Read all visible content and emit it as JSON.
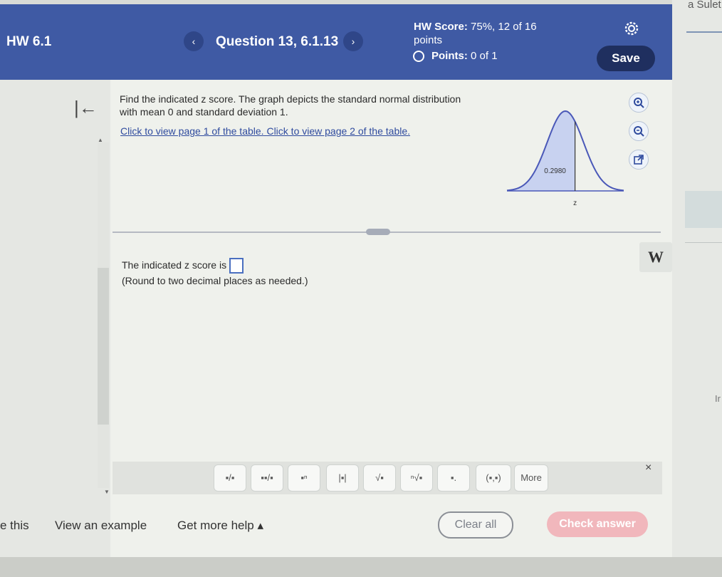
{
  "header": {
    "assignment": "HW 6.1",
    "question": "Question 13, 6.1.13",
    "prev_icon": "chevron-left-icon",
    "next_icon": "chevron-right-icon",
    "score_label": "HW Score:",
    "score_value": "75%, 12 of 16",
    "score_unit": "points",
    "points_label": "Points:",
    "points_value": "0 of 1",
    "settings_icon": "gear-icon",
    "save": "Save"
  },
  "question": {
    "text_line1": "Find the indicated z score. The graph depicts the standard normal distribution",
    "text_line2": "with mean 0 and standard deviation 1.",
    "link1": "Click to view page 1 of the table.",
    "link2": "Click to view page 2 of the table.",
    "graph_area_label": "0.2980",
    "graph_axis_label": "z",
    "shaded_area": 0.298
  },
  "tools": [
    "zoom-in-icon",
    "zoom-out-icon",
    "open-external-icon"
  ],
  "answer": {
    "prompt": "The indicated z score is",
    "hint": "(Round to two decimal places as needed.)",
    "value": ""
  },
  "side": {
    "w_button": "W",
    "corner_user": "a Sulet",
    "right_text": "Ir"
  },
  "toolbar": {
    "buttons": [
      "▪/▪",
      "▪▪/▪",
      "▪ⁿ",
      "|▪|",
      "√▪",
      "ⁿ√▪",
      "▪.",
      "(▪,▪)",
      "More"
    ],
    "close": "×"
  },
  "footer": {
    "left_cut": "e this",
    "view_example": "View an example",
    "get_help": "Get more help ▴",
    "clear_all": "Clear all",
    "check_answer": "Check answer"
  },
  "colors": {
    "header_bg": "#3f5aa4",
    "save_bg": "#1f2f5f",
    "link": "#2f4b9e",
    "check_answer_bg": "#f1b7bc",
    "curve": "#4a58b8"
  }
}
